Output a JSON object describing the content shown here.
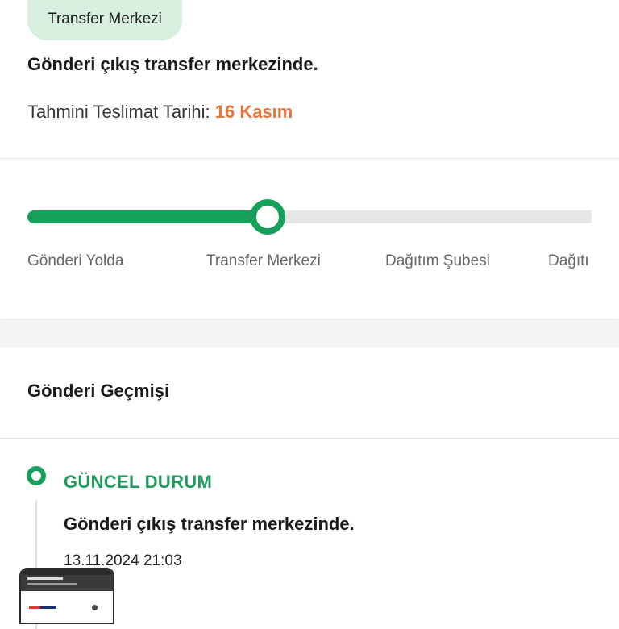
{
  "status": {
    "badge": "Transfer Merkezi",
    "message": "Gönderi çıkış transfer merkezinde.",
    "delivery_label": "Tahmini Teslimat Tarihi:",
    "delivery_date": "16 Kasım"
  },
  "progress": {
    "current_step_index": 1,
    "steps": [
      {
        "label": "Gönderi Yolda"
      },
      {
        "label": "Transfer Merkezi"
      },
      {
        "label": "Dağıtım Şubesi"
      },
      {
        "label": "Dağıtı"
      }
    ]
  },
  "history": {
    "title": "Gönderi Geçmişi",
    "events": [
      {
        "status": "GÜNCEL DURUM",
        "description": "Gönderi çıkış transfer merkezinde.",
        "timestamp": "13.11.2024 21:03"
      }
    ]
  },
  "colors": {
    "accent": "#16a05a",
    "date_highlight": "#e8733a",
    "badge_bg": "#d8efdf"
  }
}
